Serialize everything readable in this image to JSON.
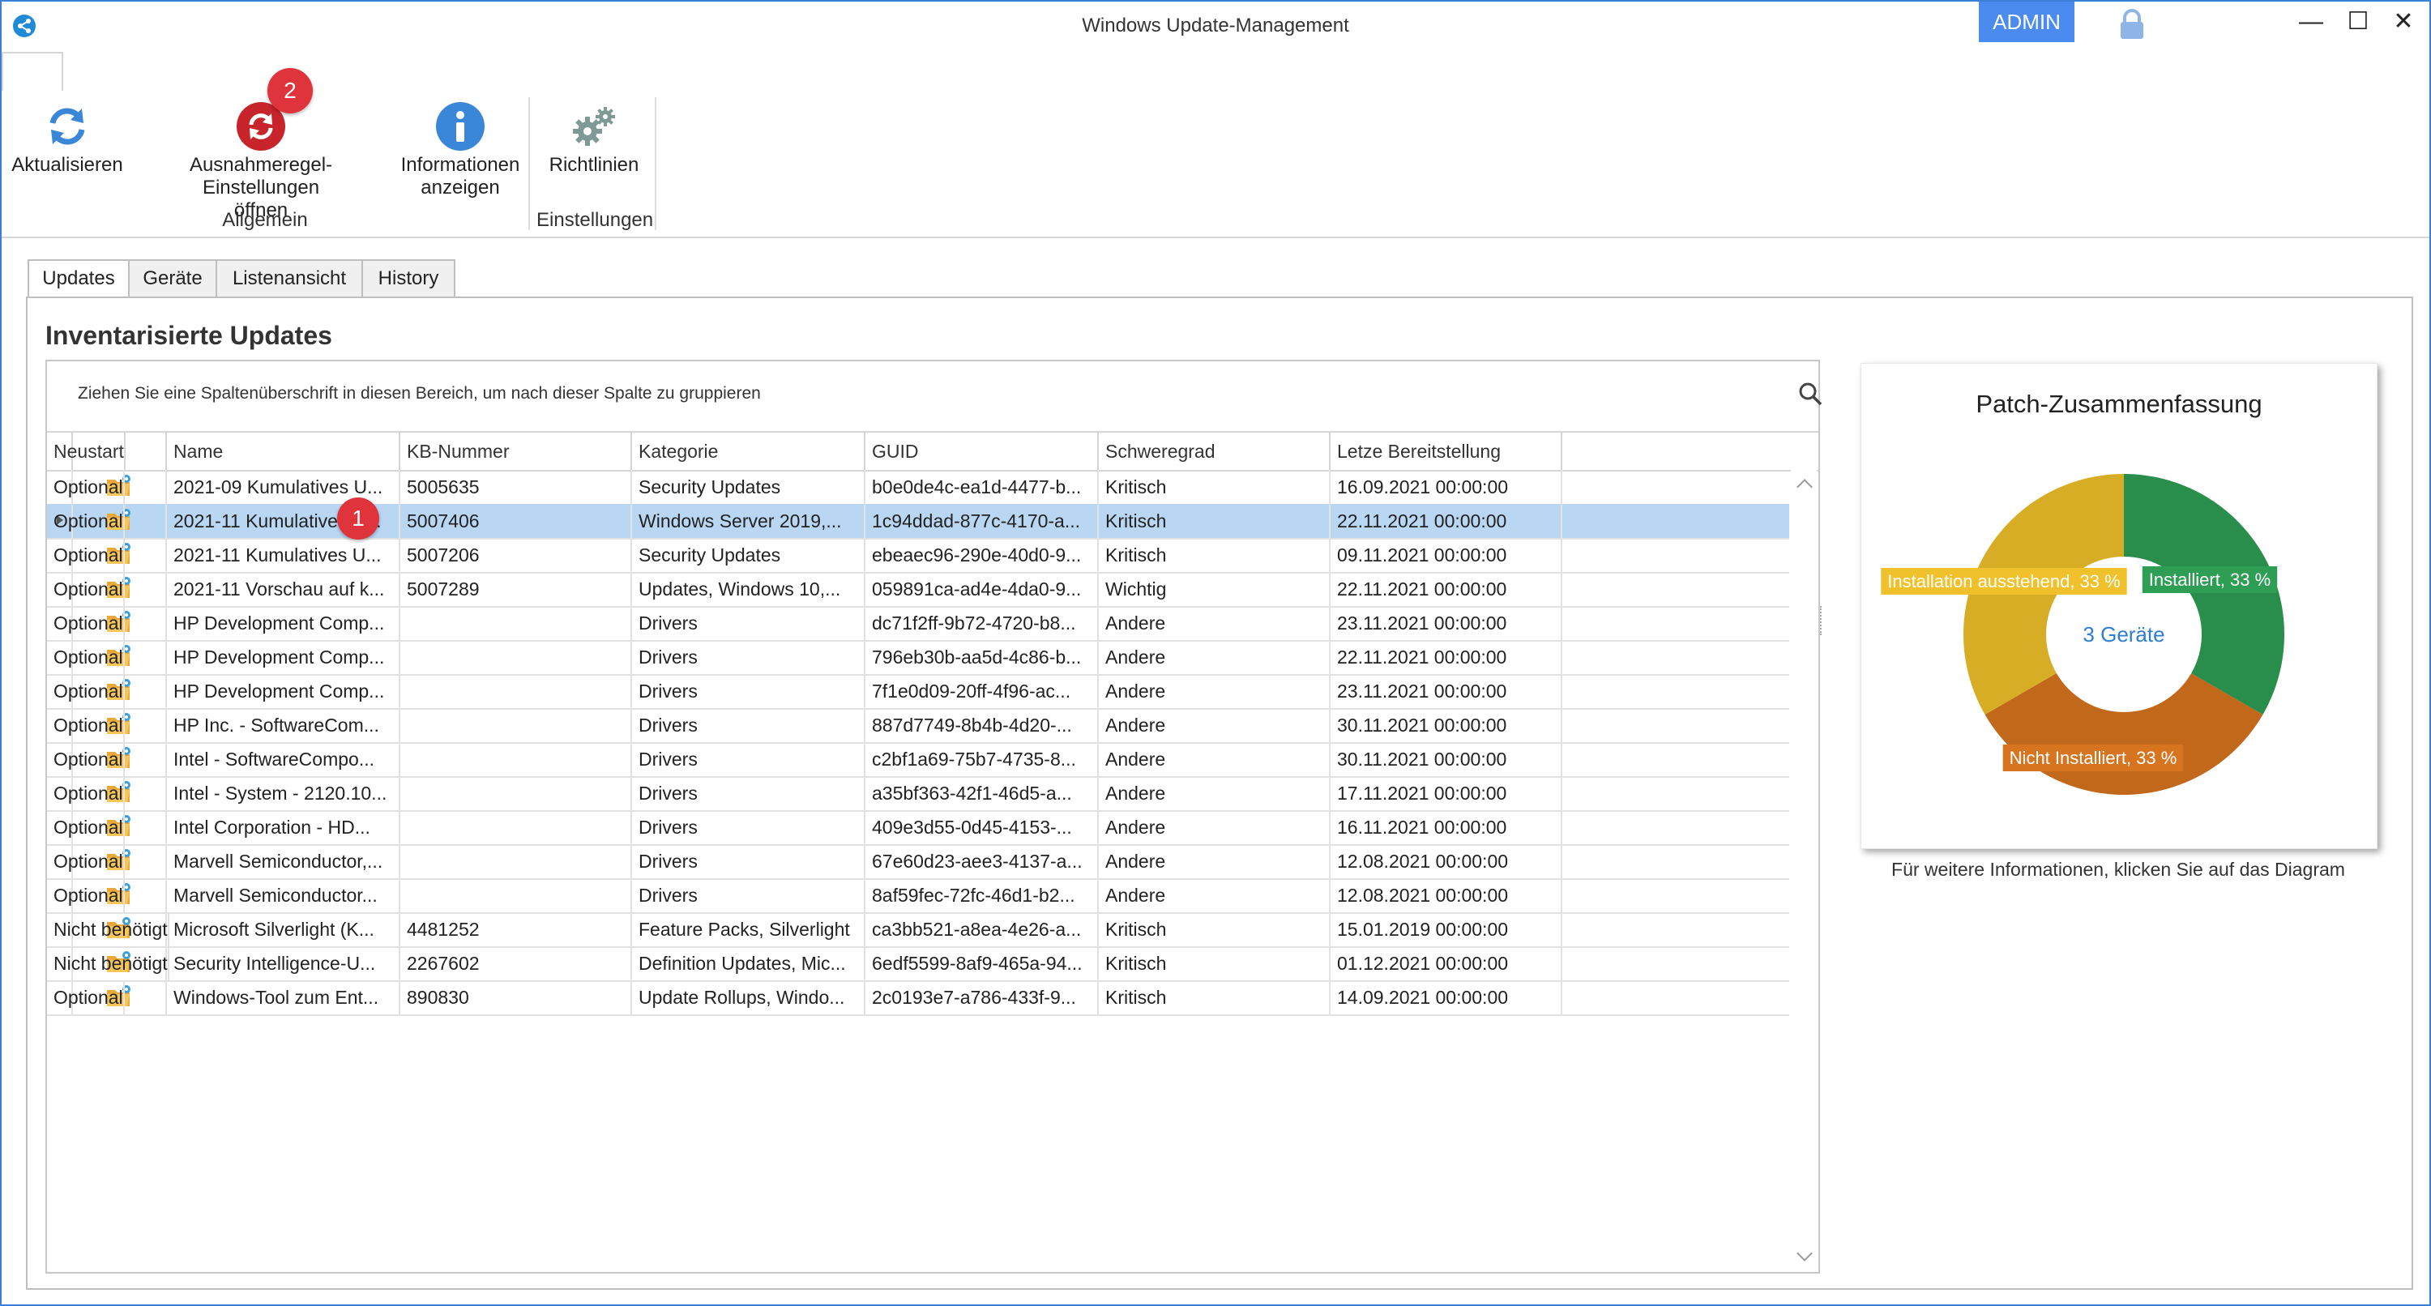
{
  "window": {
    "title": "Windows Update-Management",
    "admin_label": "ADMIN",
    "controls": [
      "—",
      "☐",
      "✕"
    ]
  },
  "ribbon": {
    "groups": [
      {
        "label": "Allgemein"
      },
      {
        "label": "Einstellungen"
      }
    ],
    "buttons": {
      "refresh": "Aktualisieren",
      "exceptions_line1": "Ausnahmeregel-Einstellungen",
      "exceptions_line2": "öffnen",
      "info_line1": "Informationen",
      "info_line2": "anzeigen",
      "policies": "Richtlinien"
    },
    "badge": "2"
  },
  "tabs": [
    "Updates",
    "Geräte",
    "Listenansicht",
    "History"
  ],
  "section_title": "Inventarisierte Updates",
  "grid": {
    "group_hint": "Ziehen Sie eine Spaltenüberschrift in diesen Bereich, um nach dieser Spalte zu gruppieren",
    "columns": [
      "Name",
      "KB-Nummer",
      "Kategorie",
      "GUID",
      "Schweregrad",
      "Letze Bereitstellung",
      "Neustart"
    ],
    "row_badge": "1",
    "rows": [
      [
        "2021-09 Kumulatives U...",
        "5005635",
        "Security Updates",
        "b0e0de4c-ea1d-4477-b...",
        "Kritisch",
        "16.09.2021 00:00:00",
        "Optional"
      ],
      [
        "2021-11 Kumulatives U...",
        "5007406",
        "Windows Server 2019,...",
        "1c94ddad-877c-4170-a...",
        "Kritisch",
        "22.11.2021 00:00:00",
        "Optional"
      ],
      [
        "2021-11 Kumulatives U...",
        "5007206",
        "Security Updates",
        "ebeaec96-290e-40d0-9...",
        "Kritisch",
        "09.11.2021 00:00:00",
        "Optional"
      ],
      [
        "2021-11 Vorschau auf k...",
        "5007289",
        "Updates, Windows 10,...",
        "059891ca-ad4e-4da0-9...",
        "Wichtig",
        "22.11.2021 00:00:00",
        "Optional"
      ],
      [
        "HP Development Comp...",
        "",
        "Drivers",
        "dc71f2ff-9b72-4720-b8...",
        "Andere",
        "23.11.2021 00:00:00",
        "Optional"
      ],
      [
        "HP Development Comp...",
        "",
        "Drivers",
        "796eb30b-aa5d-4c86-b...",
        "Andere",
        "22.11.2021 00:00:00",
        "Optional"
      ],
      [
        "HP Development Comp...",
        "",
        "Drivers",
        "7f1e0d09-20ff-4f96-ac...",
        "Andere",
        "23.11.2021 00:00:00",
        "Optional"
      ],
      [
        "HP Inc. - SoftwareCom...",
        "",
        "Drivers",
        "887d7749-8b4b-4d20-...",
        "Andere",
        "30.11.2021 00:00:00",
        "Optional"
      ],
      [
        "Intel - SoftwareCompo...",
        "",
        "Drivers",
        "c2bf1a69-75b7-4735-8...",
        "Andere",
        "30.11.2021 00:00:00",
        "Optional"
      ],
      [
        "Intel - System - 2120.10...",
        "",
        "Drivers",
        "a35bf363-42f1-46d5-a...",
        "Andere",
        "17.11.2021 00:00:00",
        "Optional"
      ],
      [
        "Intel Corporation - HD...",
        "",
        "Drivers",
        "409e3d55-0d45-4153-...",
        "Andere",
        "16.11.2021 00:00:00",
        "Optional"
      ],
      [
        "Marvell Semiconductor,...",
        "",
        "Drivers",
        "67e60d23-aee3-4137-a...",
        "Andere",
        "12.08.2021 00:00:00",
        "Optional"
      ],
      [
        "Marvell Semiconductor...",
        "",
        "Drivers",
        "8af59fec-72fc-46d1-b2...",
        "Andere",
        "12.08.2021 00:00:00",
        "Optional"
      ],
      [
        "Microsoft Silverlight (K...",
        "4481252",
        "Feature Packs, Silverlight",
        "ca3bb521-a8ea-4e26-a...",
        "Kritisch",
        "15.01.2019 00:00:00",
        "Nicht benötigt"
      ],
      [
        "Security Intelligence-U...",
        "2267602",
        "Definition Updates, Mic...",
        "6edf5599-8af9-465a-94...",
        "Kritisch",
        "01.12.2021 00:00:00",
        "Nicht benötigt"
      ],
      [
        "Windows-Tool zum Ent...",
        "890830",
        "Update Rollups, Windo...",
        "2c0193e7-a786-433f-9...",
        "Kritisch",
        "14.09.2021 00:00:00",
        "Optional"
      ]
    ],
    "selected_row": 1
  },
  "summary": {
    "title": "Patch-Zusammenfassung",
    "center_label": "3 Geräte",
    "footnote": "Für weitere Informationen, klicken Sie auf das Diagram"
  },
  "chart_data": {
    "type": "pie",
    "series": [
      {
        "name": "Installiert, 33 %",
        "value": 33.33,
        "color": "#2e9e55"
      },
      {
        "name": "Nicht Installiert, 33 %",
        "value": 33.33,
        "color": "#d7741f"
      },
      {
        "name": "Installation ausstehend, 33 %",
        "value": 33.33,
        "color": "#f0c12a"
      }
    ],
    "center_label": "3 Geräte"
  },
  "icons": [
    "app-icon",
    "refresh-icon",
    "exceptions-icon",
    "info-icon",
    "gears-icon",
    "lock-icon",
    "search-icon",
    "folder-icon"
  ]
}
